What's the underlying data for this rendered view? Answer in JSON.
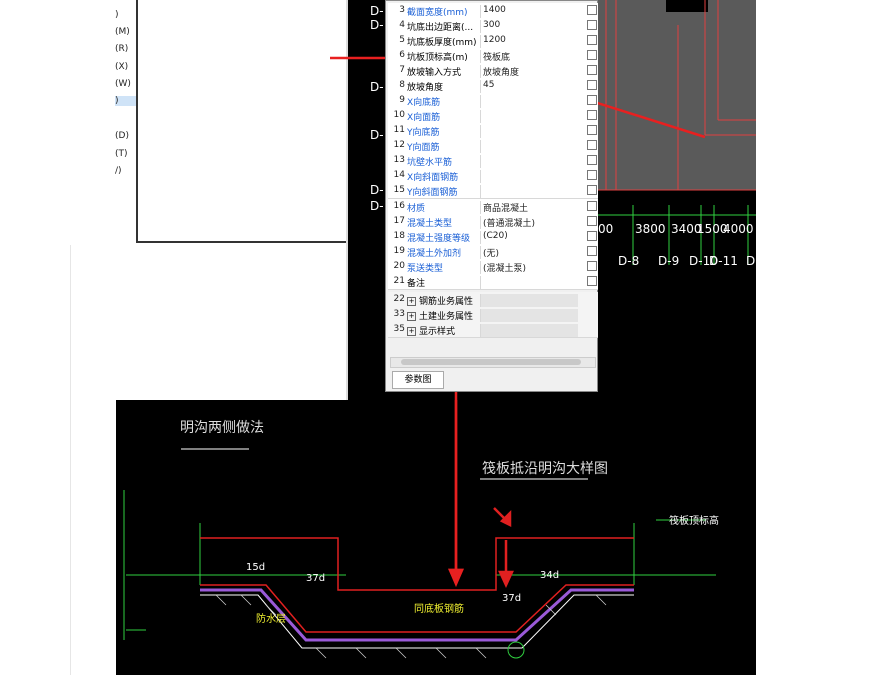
{
  "left_menu": [
    {
      "label": ")",
      "selected": false
    },
    {
      "label": "(M)",
      "selected": false
    },
    {
      "label": "(R)",
      "selected": false
    },
    {
      "label": "(X)",
      "selected": false
    },
    {
      "label": "(W)",
      "selected": false
    },
    {
      "label": ")",
      "selected": true
    },
    {
      "label": "(D)",
      "selected": false
    },
    {
      "label": "(T)",
      "selected": false
    },
    {
      "label": "/)",
      "selected": false
    }
  ],
  "property_panel": {
    "rows": [
      {
        "num": "3",
        "name": "截面宽度(mm)",
        "value": "1400",
        "blue": true
      },
      {
        "num": "4",
        "name": "坑底出边距离(...",
        "value": "300",
        "blue": false
      },
      {
        "num": "5",
        "name": "坑底板厚度(mm)",
        "value": "1200",
        "blue": false
      },
      {
        "num": "6",
        "name": "坑板顶标高(m)",
        "value": "筏板底",
        "blue": false
      },
      {
        "num": "7",
        "name": "放坡输入方式",
        "value": "放坡角度",
        "blue": false
      },
      {
        "num": "8",
        "name": "放坡角度",
        "value": "45",
        "blue": false
      },
      {
        "num": "9",
        "name": "X向底筋",
        "value": "",
        "blue": true
      },
      {
        "num": "10",
        "name": "X向面筋",
        "value": "",
        "blue": true
      },
      {
        "num": "11",
        "name": "Y向底筋",
        "value": "",
        "blue": true
      },
      {
        "num": "12",
        "name": "Y向面筋",
        "value": "",
        "blue": true
      },
      {
        "num": "13",
        "name": "坑壁水平筋",
        "value": "",
        "blue": true
      },
      {
        "num": "14",
        "name": "X向斜面钢筋",
        "value": "",
        "blue": true
      },
      {
        "num": "15",
        "name": "Y向斜面钢筋",
        "value": "",
        "blue": true
      },
      {
        "num": "16",
        "name": "材质",
        "value": "商品混凝土",
        "blue": true
      },
      {
        "num": "17",
        "name": "混凝土类型",
        "value": "(普通混凝土)",
        "blue": true
      },
      {
        "num": "18",
        "name": "混凝土强度等级",
        "value": "(C20)",
        "blue": true
      },
      {
        "num": "19",
        "name": "混凝土外加剂",
        "value": "(无)",
        "blue": true
      },
      {
        "num": "20",
        "name": "泵送类型",
        "value": "(混凝土泵)",
        "blue": true
      },
      {
        "num": "21",
        "name": "备注",
        "value": "",
        "blue": false
      }
    ],
    "groups": [
      {
        "num": "22",
        "name": "钢筋业务属性"
      },
      {
        "num": "33",
        "name": "土建业务属性"
      },
      {
        "num": "35",
        "name": "显示样式"
      }
    ],
    "param_tab": "参数图"
  },
  "cad_top": {
    "dims": [
      "00",
      "3800",
      "3400",
      "1500",
      "4000"
    ],
    "axes": [
      "D-8",
      "D-9",
      "D-10",
      "D-11",
      "D"
    ],
    "left_labels": [
      "D-",
      "D-",
      "D-",
      "D-",
      "D-",
      "D-"
    ]
  },
  "cad_drawing": {
    "title_left": "明沟两侧做法",
    "title_right": "筏板抵沿明沟大样图",
    "label_fb": "筏板顶标高",
    "label_waterproof": "防水层",
    "label_bottom": "同底板钢筋",
    "label_37d": "37d",
    "label_34d": "34d",
    "label_15d": "15d"
  }
}
